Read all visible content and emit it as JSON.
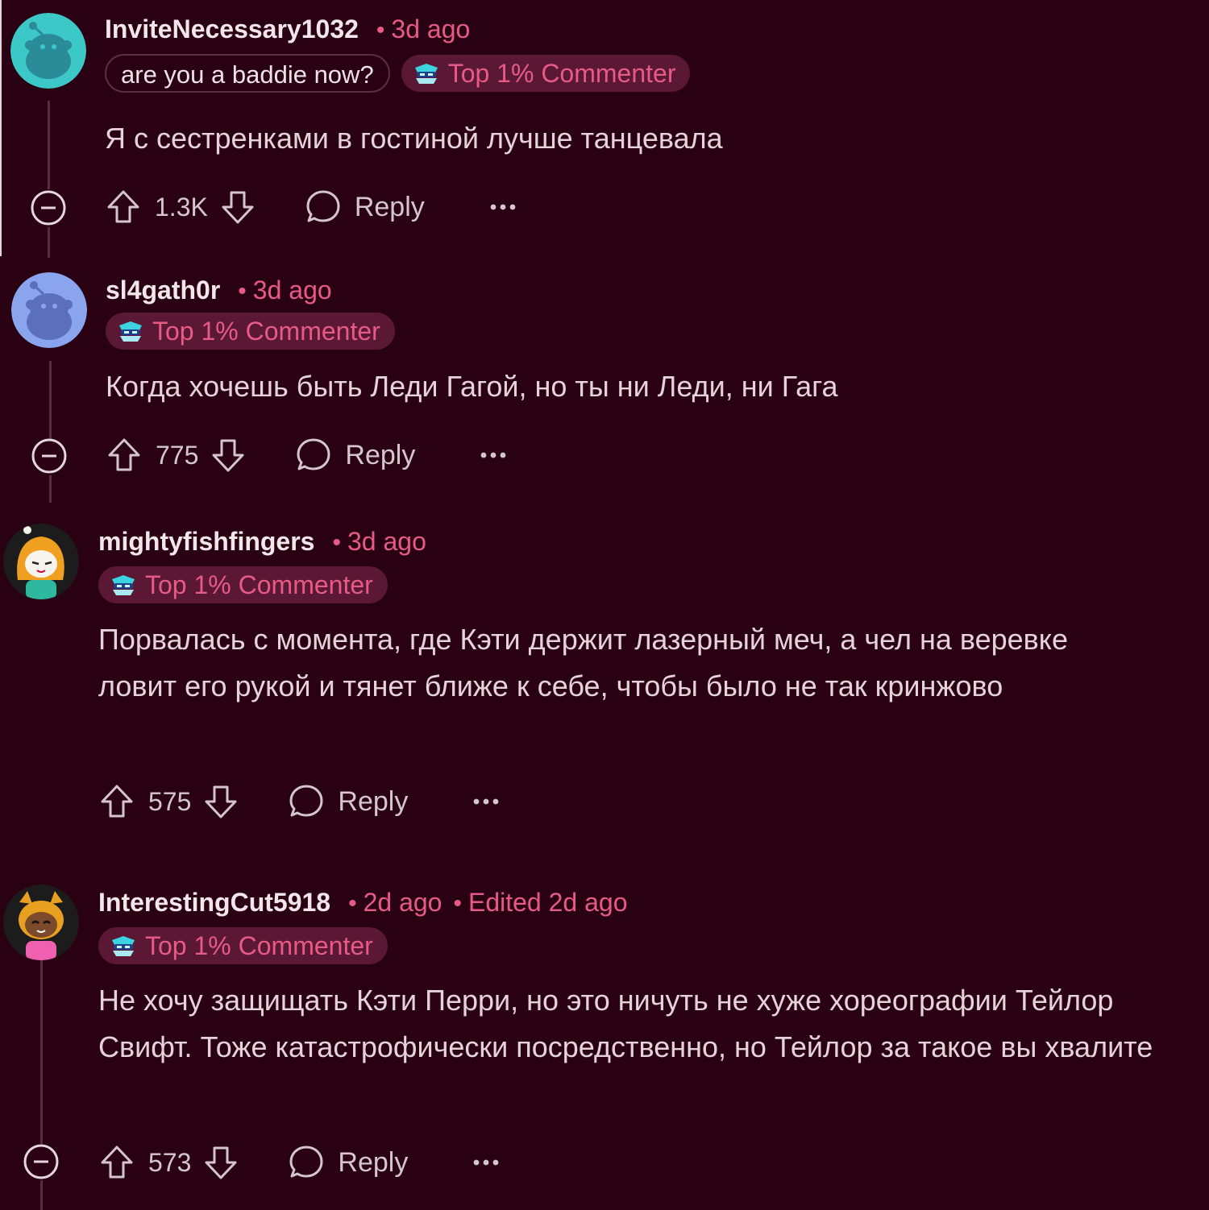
{
  "colors": {
    "background": "#2a0013",
    "accent": "#e85a86",
    "badge_bg": "#5a1835"
  },
  "comments": [
    {
      "username": "InviteNecessary1032",
      "time": "3d ago",
      "edited": "",
      "user_flair": "are you a baddie now?",
      "badge": "Top 1% Commenter",
      "text": "Я с сестренками в гостиной лучше танцевала",
      "score": "1.3K",
      "reply_label": "Reply",
      "avatar_color": "#3dc8c8",
      "icons": [
        "upvote-icon",
        "downvote-icon",
        "comment-icon",
        "more-icon",
        "collapse-icon"
      ]
    },
    {
      "username": "sl4gath0r",
      "time": "3d ago",
      "edited": "",
      "badge": "Top 1% Commenter",
      "text": "Когда хочешь быть Леди Гагой, но ты ни Леди, ни Гага",
      "score": "775",
      "reply_label": "Reply",
      "avatar_color": "#7f9ae3"
    },
    {
      "username": "mightyfishfingers",
      "time": "3d ago",
      "edited": "",
      "badge": "Top 1% Commenter",
      "text": "Порвалась с момента, где Кэти держит лазерный меч, а чел на веревке ловит его рукой и тянет ближе к себе, чтобы было не так кринжово",
      "score": "575",
      "reply_label": "Reply"
    },
    {
      "username": "InterestingCut5918",
      "time": "2d ago",
      "edited": "Edited 2d ago",
      "badge": "Top 1% Commenter",
      "text": "Не хочу защищать Кэти Перри, но это ничуть не хуже хореографии Тейлор Свифт. Тоже катастрофически посредственно, но Тейлор за такое вы хвалите",
      "score": "573",
      "reply_label": "Reply"
    }
  ]
}
